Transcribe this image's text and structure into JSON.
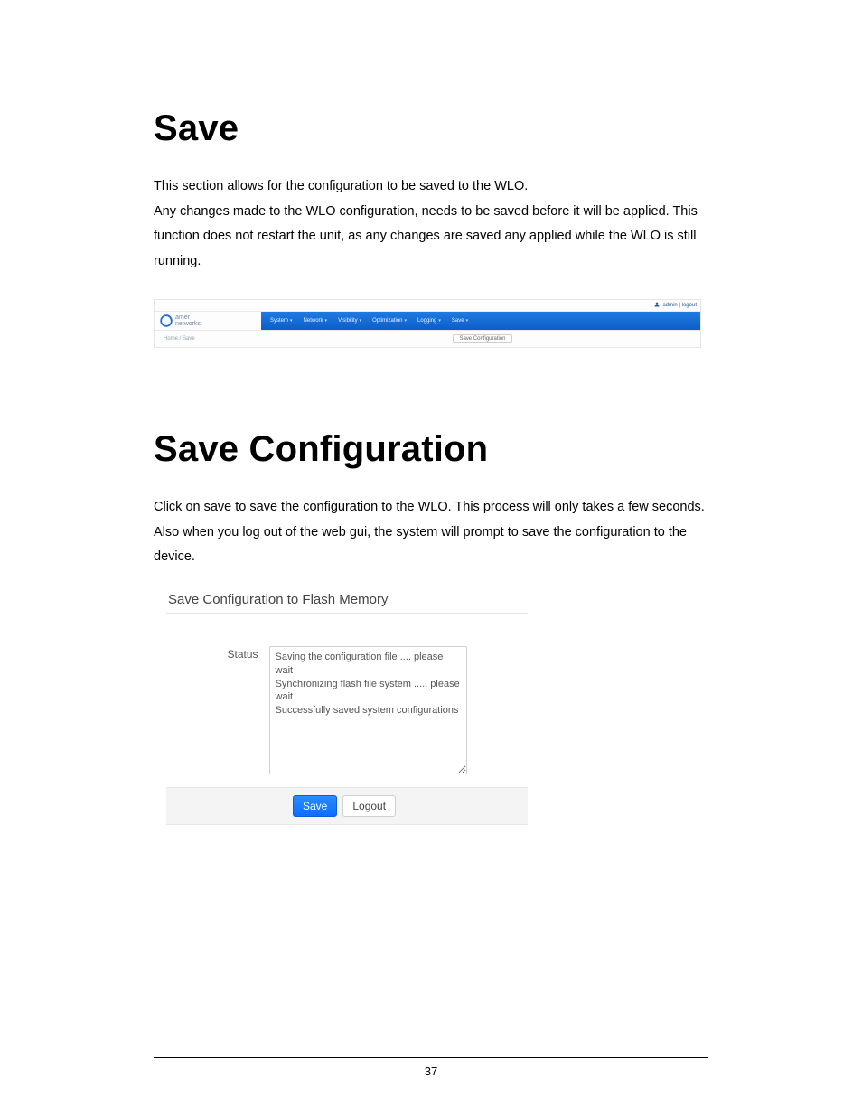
{
  "heading1": "Save",
  "para1": "This section allows for the configuration to be saved to the WLO.",
  "para2": "Any changes made to the WLO configuration, needs to be saved before it will be applied. This function does not restart the unit, as any changes are saved any applied while the WLO is still running.",
  "shot1": {
    "user_label": "admin | logout",
    "logo_line1": "amer",
    "logo_line2": "networks",
    "nav": [
      "System",
      "Network",
      "Visibility",
      "Optimization",
      "Logging",
      "Save"
    ],
    "breadcrumb": "Home / Save",
    "button_label": "Save Configuration"
  },
  "heading2": "Save Configuration",
  "para3": "Click on save to save the configuration to the WLO. This process will only takes a few seconds.",
  "para4": "Also when you log out of the web gui, the system will prompt to save the configuration to the device.",
  "shot2": {
    "panel_title": "Save Configuration to Flash Memory",
    "status_label": "Status",
    "status_text": "Saving the configuration file .... please wait\nSynchronizing flash file system ..... please wait\nSuccessfully saved system configurations",
    "save_label": "Save",
    "logout_label": "Logout"
  },
  "page_number": "37"
}
